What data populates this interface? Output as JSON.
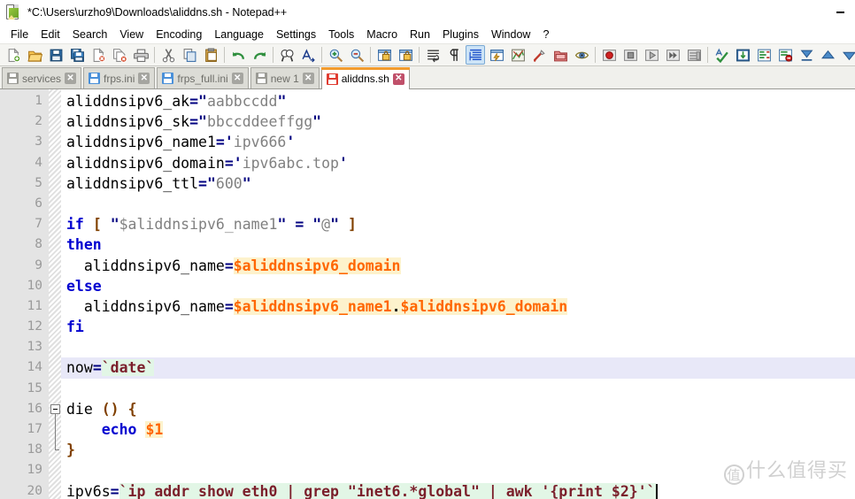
{
  "window": {
    "title": "*C:\\Users\\urzho9\\Downloads\\aliddns.sh - Notepad++",
    "icon": "notepad-plus-plus-icon",
    "minimize_label": "—"
  },
  "menu": {
    "items": [
      {
        "label": "File"
      },
      {
        "label": "Edit"
      },
      {
        "label": "Search"
      },
      {
        "label": "View"
      },
      {
        "label": "Encoding"
      },
      {
        "label": "Language"
      },
      {
        "label": "Settings"
      },
      {
        "label": "Tools"
      },
      {
        "label": "Macro"
      },
      {
        "label": "Run"
      },
      {
        "label": "Plugins"
      },
      {
        "label": "Window"
      },
      {
        "label": "?"
      }
    ]
  },
  "toolbar": {
    "items": [
      {
        "name": "new-file-icon"
      },
      {
        "name": "open-file-icon"
      },
      {
        "name": "save-icon"
      },
      {
        "name": "save-all-icon"
      },
      {
        "name": "close-file-icon"
      },
      {
        "name": "close-all-files-icon"
      },
      {
        "name": "print-icon"
      },
      {
        "name": "separator"
      },
      {
        "name": "cut-icon"
      },
      {
        "name": "copy-icon"
      },
      {
        "name": "paste-icon"
      },
      {
        "name": "separator"
      },
      {
        "name": "undo-icon"
      },
      {
        "name": "redo-icon"
      },
      {
        "name": "separator"
      },
      {
        "name": "find-icon"
      },
      {
        "name": "replace-icon"
      },
      {
        "name": "separator"
      },
      {
        "name": "zoom-in-icon"
      },
      {
        "name": "zoom-out-icon"
      },
      {
        "name": "separator"
      },
      {
        "name": "sync-vertical-scrolling-icon"
      },
      {
        "name": "sync-horizontal-scrolling-icon"
      },
      {
        "name": "separator"
      },
      {
        "name": "word-wrap-icon"
      },
      {
        "name": "show-all-characters-icon"
      },
      {
        "name": "show-indent-guide-icon"
      },
      {
        "name": "user-defined-dialog-icon"
      },
      {
        "name": "show-doc-map-icon"
      },
      {
        "name": "function-list-icon"
      },
      {
        "name": "folder-as-workspace-icon"
      },
      {
        "name": "monitoring-icon"
      },
      {
        "name": "separator"
      },
      {
        "name": "start-record-macro-icon"
      },
      {
        "name": "stop-record-macro-icon"
      },
      {
        "name": "playback-macro-icon"
      },
      {
        "name": "run-macro-multiple-icon"
      },
      {
        "name": "save-macro-icon"
      },
      {
        "name": "separator"
      },
      {
        "name": "spell-check-icon"
      },
      {
        "name": "column-editor-icon"
      },
      {
        "name": "remove-empty-lines-icon"
      },
      {
        "name": "remove-duplicate-lines-icon"
      },
      {
        "name": "sort-ascending-icon"
      },
      {
        "name": "move-up-icon"
      },
      {
        "name": "move-down-icon"
      },
      {
        "name": "sort-descending-icon"
      }
    ]
  },
  "tabs": [
    {
      "label": "services",
      "state": "saved-inactive",
      "icon_color": "gray",
      "active": false
    },
    {
      "label": "frps.ini",
      "state": "saved",
      "icon_color": "blue",
      "active": false
    },
    {
      "label": "frps_full.ini",
      "state": "saved",
      "icon_color": "blue",
      "active": false
    },
    {
      "label": "new 1",
      "state": "saved-inactive",
      "icon_color": "gray",
      "active": false
    },
    {
      "label": "aliddns.sh",
      "state": "modified",
      "icon_color": "red",
      "active": true
    }
  ],
  "editor": {
    "current_line": 14,
    "first_visible_line": 1,
    "language": "Shell",
    "lines": [
      {
        "num": 1,
        "tokens": [
          {
            "t": "aliddnsipv6_ak",
            "c": "plain"
          },
          {
            "t": "=",
            "c": "eq"
          },
          {
            "t": "\"",
            "c": "quote"
          },
          {
            "t": "aabbccdd",
            "c": "str"
          },
          {
            "t": "\"",
            "c": "quote"
          }
        ]
      },
      {
        "num": 2,
        "tokens": [
          {
            "t": "aliddnsipv6_sk",
            "c": "plain"
          },
          {
            "t": "=",
            "c": "eq"
          },
          {
            "t": "\"",
            "c": "quote"
          },
          {
            "t": "bbccddeeffgg",
            "c": "str"
          },
          {
            "t": "\"",
            "c": "quote"
          }
        ]
      },
      {
        "num": 3,
        "tokens": [
          {
            "t": "aliddnsipv6_name1",
            "c": "plain"
          },
          {
            "t": "=",
            "c": "eq"
          },
          {
            "t": "'",
            "c": "quote"
          },
          {
            "t": "ipv666",
            "c": "str"
          },
          {
            "t": "'",
            "c": "quote"
          }
        ]
      },
      {
        "num": 4,
        "tokens": [
          {
            "t": "aliddnsipv6_domain",
            "c": "plain"
          },
          {
            "t": "=",
            "c": "eq"
          },
          {
            "t": "'",
            "c": "quote"
          },
          {
            "t": "ipv6abc.top",
            "c": "str"
          },
          {
            "t": "'",
            "c": "quote"
          }
        ]
      },
      {
        "num": 5,
        "tokens": [
          {
            "t": "aliddnsipv6_ttl",
            "c": "plain"
          },
          {
            "t": "=",
            "c": "eq"
          },
          {
            "t": "\"",
            "c": "quote"
          },
          {
            "t": "600",
            "c": "str"
          },
          {
            "t": "\"",
            "c": "quote"
          }
        ]
      },
      {
        "num": 6,
        "tokens": []
      },
      {
        "num": 7,
        "tokens": [
          {
            "t": "if",
            "c": "kw"
          },
          {
            "t": " ",
            "c": "plain"
          },
          {
            "t": "[",
            "c": "brk"
          },
          {
            "t": " ",
            "c": "plain"
          },
          {
            "t": "\"",
            "c": "quote"
          },
          {
            "t": "$aliddnsipv6_name1",
            "c": "str"
          },
          {
            "t": "\"",
            "c": "quote"
          },
          {
            "t": " ",
            "c": "plain"
          },
          {
            "t": "=",
            "c": "eq"
          },
          {
            "t": " ",
            "c": "plain"
          },
          {
            "t": "\"",
            "c": "quote"
          },
          {
            "t": "@",
            "c": "str"
          },
          {
            "t": "\"",
            "c": "quote"
          },
          {
            "t": " ",
            "c": "plain"
          },
          {
            "t": "]",
            "c": "brk"
          }
        ]
      },
      {
        "num": 8,
        "tokens": [
          {
            "t": "then",
            "c": "kw"
          }
        ]
      },
      {
        "num": 9,
        "tokens": [
          {
            "t": "  aliddnsipv6_name",
            "c": "plain"
          },
          {
            "t": "=",
            "c": "eq"
          },
          {
            "t": "$aliddnsipv6_domain",
            "c": "var-hl"
          }
        ]
      },
      {
        "num": 10,
        "tokens": [
          {
            "t": "else",
            "c": "kw"
          }
        ]
      },
      {
        "num": 11,
        "tokens": [
          {
            "t": "  aliddnsipv6_name",
            "c": "plain"
          },
          {
            "t": "=",
            "c": "eq"
          },
          {
            "t": "$aliddnsipv6_name1",
            "c": "var-hl"
          },
          {
            "t": ".",
            "c": "dot-hl"
          },
          {
            "t": "$aliddnsipv6_domain",
            "c": "var-hl"
          }
        ]
      },
      {
        "num": 12,
        "tokens": [
          {
            "t": "fi",
            "c": "kw"
          }
        ]
      },
      {
        "num": 13,
        "tokens": []
      },
      {
        "num": 14,
        "current": true,
        "tokens": [
          {
            "t": "now",
            "c": "plain"
          },
          {
            "t": "=",
            "c": "eq"
          },
          {
            "t": "`date`",
            "c": "cmd"
          }
        ]
      },
      {
        "num": 15,
        "tokens": []
      },
      {
        "num": 16,
        "fold": "start",
        "tokens": [
          {
            "t": "die",
            "c": "plain"
          },
          {
            "t": " ",
            "c": "plain"
          },
          {
            "t": "()",
            "c": "brk"
          },
          {
            "t": " ",
            "c": "plain"
          },
          {
            "t": "{",
            "c": "brk"
          }
        ]
      },
      {
        "num": 17,
        "fold": "mid",
        "tokens": [
          {
            "t": "    ",
            "c": "plain"
          },
          {
            "t": "echo",
            "c": "kw"
          },
          {
            "t": " ",
            "c": "plain"
          },
          {
            "t": "$1",
            "c": "var-hl"
          }
        ]
      },
      {
        "num": 18,
        "fold": "end",
        "tokens": [
          {
            "t": "}",
            "c": "brk"
          }
        ]
      },
      {
        "num": 19,
        "tokens": []
      },
      {
        "num": 20,
        "caret": true,
        "tokens": [
          {
            "t": "ipv6s",
            "c": "plain"
          },
          {
            "t": "=",
            "c": "eq"
          },
          {
            "t": "`ip addr show eth0 | grep \"inet6.*global\" | awk '{print $2}'`",
            "c": "cmd"
          }
        ]
      }
    ]
  },
  "watermark": {
    "badge": "值",
    "text": "什么值得买"
  },
  "colors": {
    "accent_tab": "#f29b2e",
    "keyword": "#0000d0",
    "variable": "#ff6600",
    "string": "#808080",
    "command": "#7b1f2b",
    "command_bg": "#e2f6e6",
    "highlight_bg": "#fdf2cc",
    "current_line_bg": "#e8e8f8",
    "gutter_bg": "#e4e4e4",
    "toolbar_bg": "#f5f5f2"
  }
}
